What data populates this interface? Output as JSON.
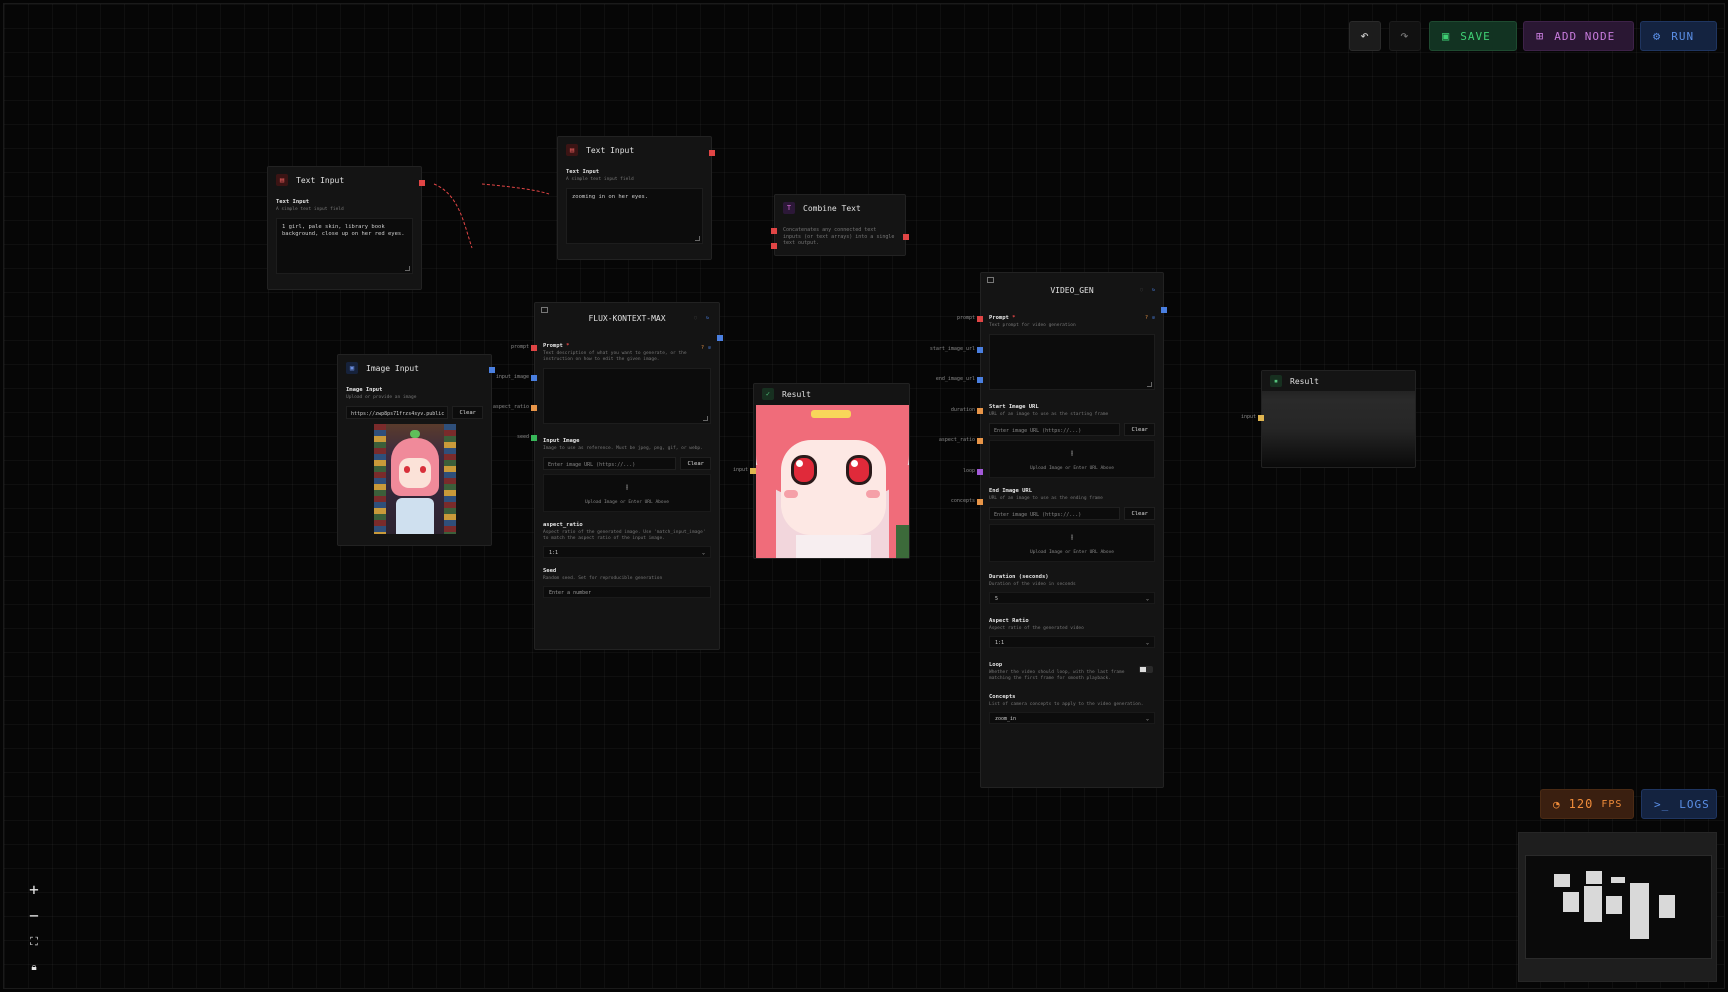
{
  "toolbar": {
    "undo_icon": "undo-icon",
    "redo_icon": "redo-icon",
    "save_label": "SAVE",
    "add_node_label": "ADD NODE",
    "run_label": "RUN"
  },
  "text_input_1": {
    "title": "Text Input",
    "field_label": "Text Input",
    "field_desc": "A simple text input field",
    "value": "1 girl, pale skin, library book background, close up on her red eyes."
  },
  "text_input_2": {
    "title": "Text Input",
    "field_label": "Text Input",
    "field_desc": "A simple text input field",
    "value": "zooming in on her eyes."
  },
  "combine_text": {
    "title": "Combine Text",
    "desc": "Concatenates any connected text inputs (or text arrays) into a single text output."
  },
  "image_input": {
    "title": "Image Input",
    "field_label": "Image Input",
    "field_desc": "Upload or provide an image",
    "url_value": "https://zwp8ps71frzs4syv.public",
    "clear_label": "Clear"
  },
  "flux": {
    "title": "FLUX-KONTEXT-MAX",
    "port_labels": [
      "prompt",
      "input_image",
      "aspect_ratio",
      "seed"
    ],
    "prompt_label": "Prompt",
    "prompt_desc": "Text description of what you want to generate, or the instruction on how to edit the given image.",
    "input_image_label": "Input Image",
    "input_image_desc": "Image to use as reference. Must be jpeg, png, gif, or webp.",
    "url_placeholder": "Enter image URL (https://...)",
    "clear_label": "Clear",
    "upload_text": "Upload Image or Enter URL Above",
    "aspect_label": "aspect_ratio",
    "aspect_desc": "Aspect ratio of the generated image. Use 'match_input_image' to match the aspect ratio of the input image.",
    "aspect_value": "1:1",
    "seed_label": "Seed",
    "seed_desc": "Random seed. Set for reproducible generation",
    "seed_placeholder": "Enter a number"
  },
  "result_1": {
    "title": "Result",
    "port_label": "input"
  },
  "video_gen": {
    "title": "VIDEO_GEN",
    "port_labels": [
      "prompt",
      "start_image_url",
      "end_image_url",
      "duration",
      "aspect_ratio",
      "loop",
      "concepts"
    ],
    "prompt_label": "Prompt",
    "prompt_desc": "Text prompt for video generation",
    "start_label": "Start Image URL",
    "start_desc": "URL of an image to use as the starting frame",
    "end_label": "End Image URL",
    "end_desc": "URL of an image to use as the ending frame",
    "url_placeholder": "Enter image URL (https://...)",
    "clear_label": "Clear",
    "upload_text": "Upload Image or Enter URL Above",
    "duration_label": "Duration (seconds)",
    "duration_desc": "Duration of the video in seconds",
    "duration_value": "5",
    "aspect_label": "Aspect Ratio",
    "aspect_desc": "Aspect ratio of the generated video",
    "aspect_value": "1:1",
    "loop_label": "Loop",
    "loop_desc": "Whether the video should loop, with the last frame matching the first frame for smooth playback.",
    "concepts_label": "Concepts",
    "concepts_desc": "List of camera concepts to apply to the video generation.",
    "concepts_value": "zoom_in"
  },
  "result_2": {
    "title": "Result",
    "port_label": "input"
  },
  "status": {
    "fps_value": "120",
    "fps_unit": "FPS",
    "logs_label": "LOGS"
  },
  "colors": {
    "save": "#3fcf74",
    "add_node": "#c77bdc",
    "run": "#5b8fe6",
    "fps": "#f08c3a",
    "logs": "#5b8fe6",
    "edge": "#e04545"
  }
}
